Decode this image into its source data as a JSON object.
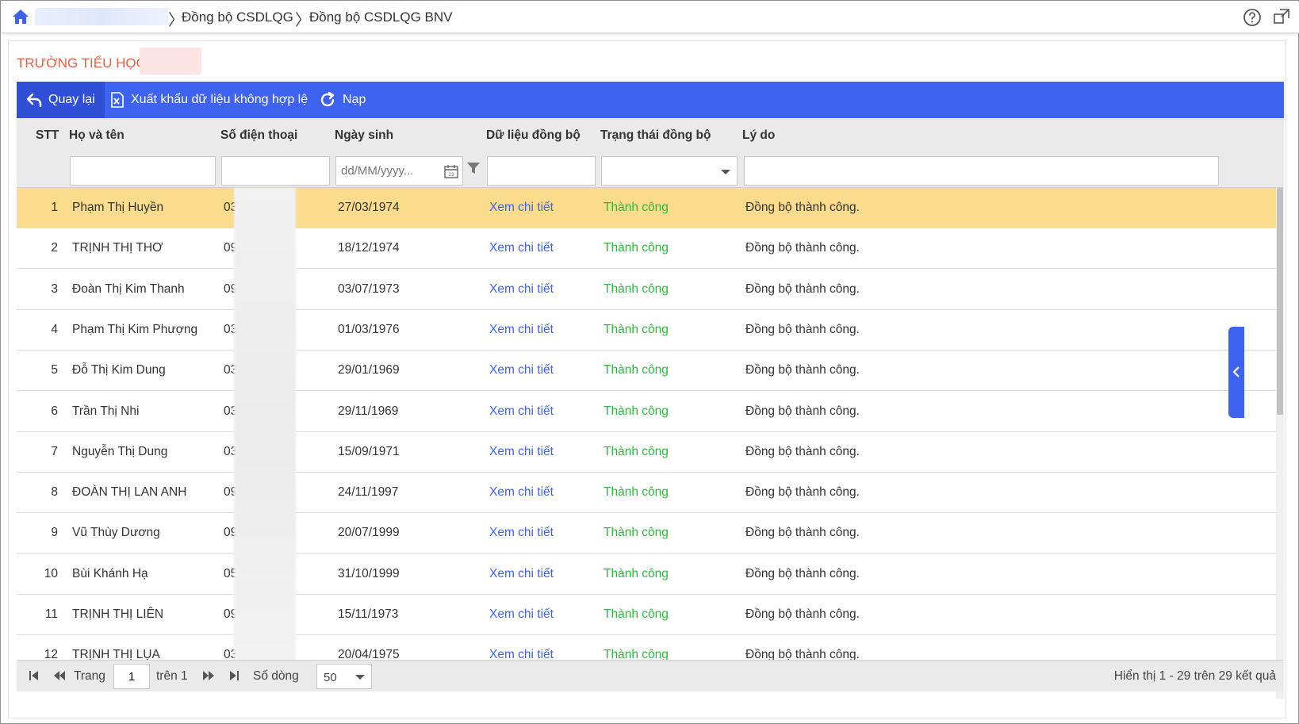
{
  "breadcrumb": {
    "items": [
      "Đồng bộ CSDLQG",
      "Đồng bộ CSDLQG BNV"
    ]
  },
  "school": {
    "name": "TRƯỜNG TIỂU HỌC"
  },
  "toolbar": {
    "back_label": "Quay lại",
    "export_label": "Xuất khẩu dữ liệu không hợp lệ",
    "reload_label": "Nạp"
  },
  "table": {
    "columns": [
      "STT",
      "Họ và tên",
      "Số điện thoại",
      "Ngày sinh",
      "Dữ liệu đồng bộ",
      "Trạng thái đồng bộ",
      "Lý do"
    ],
    "filters": {
      "date_placeholder": "dd/MM/yyyy..."
    },
    "rows": [
      {
        "stt": "1",
        "name": "Phạm Thị Huyền",
        "phone": "038",
        "dob": "27/03/1974",
        "data": "Xem chi tiết",
        "status": "Thành công",
        "reason": "Đồng bộ thành công."
      },
      {
        "stt": "2",
        "name": "TRỊNH THỊ THƠ",
        "phone": "098",
        "dob": "18/12/1974",
        "data": "Xem chi tiết",
        "status": "Thành công",
        "reason": "Đồng bộ thành công."
      },
      {
        "stt": "3",
        "name": "Đoàn Thị Kim Thanh",
        "phone": "098",
        "dob": "03/07/1973",
        "data": "Xem chi tiết",
        "status": "Thành công",
        "reason": "Đồng bộ thành công."
      },
      {
        "stt": "4",
        "name": "Phạm Thị Kim Phượng",
        "phone": "036",
        "dob": "01/03/1976",
        "data": "Xem chi tiết",
        "status": "Thành công",
        "reason": "Đồng bộ thành công."
      },
      {
        "stt": "5",
        "name": "Đỗ Thị Kim Dung",
        "phone": "032",
        "dob": "29/01/1969",
        "data": "Xem chi tiết",
        "status": "Thành công",
        "reason": "Đồng bộ thành công."
      },
      {
        "stt": "6",
        "name": "Trần Thị Nhi",
        "phone": "035",
        "dob": "29/11/1969",
        "data": "Xem chi tiết",
        "status": "Thành công",
        "reason": "Đồng bộ thành công."
      },
      {
        "stt": "7",
        "name": "Nguyễn Thị Dung",
        "phone": "038",
        "dob": "15/09/1971",
        "data": "Xem chi tiết",
        "status": "Thành công",
        "reason": "Đồng bộ thành công."
      },
      {
        "stt": "8",
        "name": "ĐOÀN THỊ LAN ANH",
        "phone": "096",
        "dob": "24/11/1997",
        "data": "Xem chi tiết",
        "status": "Thành công",
        "reason": "Đồng bộ thành công."
      },
      {
        "stt": "9",
        "name": "Vũ Thùy Dương",
        "phone": "092",
        "dob": "20/07/1999",
        "data": "Xem chi tiết",
        "status": "Thành công",
        "reason": "Đồng bộ thành công."
      },
      {
        "stt": "10",
        "name": "Bùi Khánh Hạ",
        "phone": "058",
        "dob": "31/10/1999",
        "data": "Xem chi tiết",
        "status": "Thành công",
        "reason": "Đồng bộ thành công."
      },
      {
        "stt": "11",
        "name": "TRỊNH THỊ LIÊN",
        "phone": "093",
        "dob": "15/11/1973",
        "data": "Xem chi tiết",
        "status": "Thành công",
        "reason": "Đồng bộ thành công."
      },
      {
        "stt": "12",
        "name": "TRỊNH THỊ LỤA",
        "phone": "035",
        "dob": "20/04/1975",
        "data": "Xem chi tiết",
        "status": "Thành công",
        "reason": "Đồng bộ thành công."
      }
    ]
  },
  "pager": {
    "page_label": "Trang",
    "page_value": "1",
    "of_label": "trên 1",
    "rows_label": "Số dòng",
    "rows_value": "50",
    "summary": "Hiển thị 1 - 29 trên 29 kết quả"
  },
  "colors": {
    "accent": "#3d63f0",
    "selected_row": "#fbdc8d",
    "success": "#2db83d",
    "school": "#e8603c"
  }
}
